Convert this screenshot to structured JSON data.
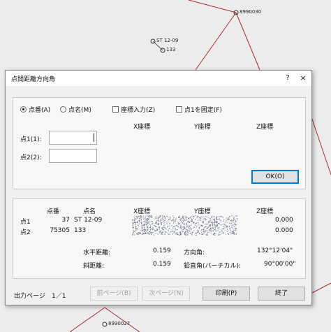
{
  "background": {
    "point_labels": [
      "8990030",
      "ST 12-09",
      "133",
      "8990027"
    ]
  },
  "dialog": {
    "title": "点間距離方向角",
    "help_label": "?",
    "close_label": "×",
    "options": {
      "by_number": "点番(A)",
      "by_name": "点名(M)",
      "coord_input": "座標入力(Z)",
      "fix_point1": "点1を固定(F)"
    },
    "input_headers": {
      "x": "X座標",
      "y": "Y座標",
      "z": "Z座標"
    },
    "point1_label": "点1(1):",
    "point2_label": "点2(2):",
    "point1_value": "",
    "point2_value": "",
    "ok_label": "OK(O)",
    "results": {
      "headers": {
        "number": "点番",
        "name": "点名",
        "x": "X座標",
        "y": "Y座標",
        "z": "Z座標"
      },
      "rows": [
        {
          "label": "点1",
          "number": "37",
          "name": "ST 12-09",
          "z": "0.000"
        },
        {
          "label": "点2",
          "number": "75305",
          "name": "133",
          "z": "0.000"
        }
      ],
      "horizontal_distance_label": "水平距離:",
      "horizontal_distance": "0.159",
      "slope_distance_label": "斜距離:",
      "slope_distance": "0.159",
      "direction_angle_label": "方向角:",
      "direction_angle": "132°12'04\"",
      "vertical_angle_label": "鉛直角(バーチカル):",
      "vertical_angle": "90°00'00\""
    },
    "footer": {
      "output_page_label": "出力ページ",
      "page": "1／1",
      "prev_label": "前ページ(B)",
      "next_label": "次ページ(N)",
      "print_label": "印刷(P)",
      "exit_label": "終了"
    }
  }
}
